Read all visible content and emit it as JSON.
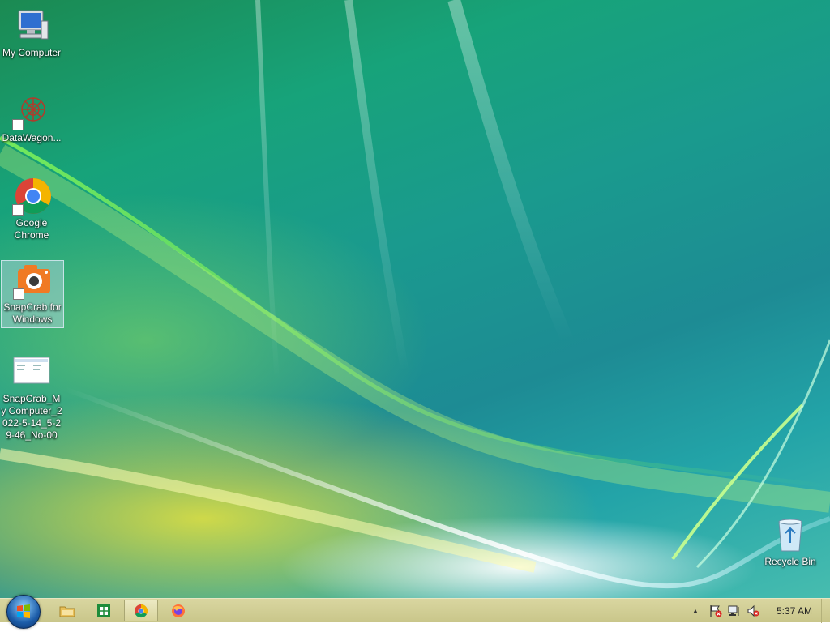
{
  "desktop": {
    "icons": [
      {
        "id": "my-computer",
        "label": "My Computer"
      },
      {
        "id": "datawagon",
        "label": "DataWagon..."
      },
      {
        "id": "google-chrome",
        "label": "Google Chrome"
      },
      {
        "id": "snapcrab",
        "label": "SnapCrab for Windows"
      },
      {
        "id": "snapcrab-file",
        "label": "SnapCrab_My Computer_2022-5-14_5-29-46_No-00"
      },
      {
        "id": "recycle-bin",
        "label": "Recycle Bin"
      }
    ]
  },
  "taskbar": {
    "start_icon": "windows-logo-icon",
    "pinned": [
      {
        "name": "file-explorer",
        "icon": "folder-icon"
      },
      {
        "name": "spreadsheet",
        "icon": "spreadsheet-icon"
      },
      {
        "name": "chrome",
        "icon": "chrome-icon",
        "active": true
      },
      {
        "name": "firefox",
        "icon": "firefox-icon"
      }
    ],
    "tray": {
      "items": [
        "show-hidden-icons-chevron",
        "action-center-flag-icon",
        "network-icon",
        "volume-muted-icon"
      ],
      "chevron": "▲",
      "clock": "5:37 AM"
    }
  },
  "colors": {
    "taskbar_bg": "#d2cf94",
    "wallpaper_teal": "#1a9a8e",
    "wallpaper_green": "#1b8a52",
    "wallpaper_yellow": "#eee63c"
  }
}
